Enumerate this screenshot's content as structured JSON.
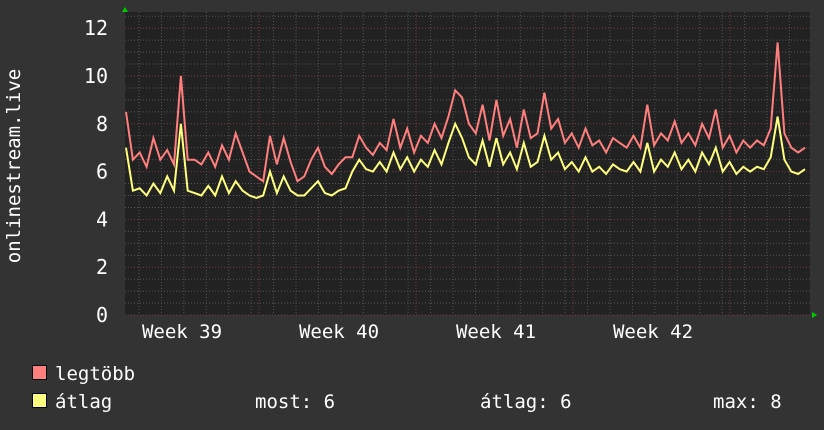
{
  "chart_data": {
    "type": "line",
    "title": "",
    "ylabel": "onlinestream.live",
    "xlabel": "",
    "ylim": [
      0,
      12.5
    ],
    "yticks": [
      "0",
      "2",
      "4",
      "6",
      "8",
      "10",
      "12"
    ],
    "xticks": [
      "Week 39",
      "Week 40",
      "Week 41",
      "Week 42"
    ],
    "grid": true,
    "legend_placement": "bottom-left",
    "series": [
      {
        "name": "legtöbb",
        "color": "#ff7f7f",
        "values": [
          8.5,
          6.5,
          6.8,
          6.2,
          7.4,
          6.5,
          6.9,
          6.3,
          10,
          6.5,
          6.5,
          6.3,
          6.8,
          6.2,
          7.1,
          6.5,
          7.6,
          6.8,
          6.0,
          5.8,
          5.6,
          7.5,
          6.3,
          7.4,
          6.4,
          5.6,
          5.8,
          6.5,
          7.0,
          6.2,
          5.9,
          6.3,
          6.6,
          6.6,
          7.5,
          7.0,
          6.7,
          7.2,
          6.9,
          8.2,
          7.0,
          7.8,
          6.8,
          7.5,
          7.2,
          8.0,
          7.4,
          8.3,
          9.4,
          9.1,
          8.0,
          7.6,
          8.8,
          7.3,
          9.0,
          7.5,
          8.2,
          7.0,
          8.6,
          7.4,
          7.6,
          9.3,
          7.8,
          8.2,
          7.2,
          7.6,
          7.0,
          7.8,
          7.1,
          7.3,
          6.8,
          7.4,
          7.2,
          7.0,
          7.5,
          7.0,
          8.8,
          7.1,
          7.6,
          7.3,
          8.1,
          7.2,
          7.6,
          7.1,
          8.0,
          7.4,
          8.6,
          7.0,
          7.5,
          6.8,
          7.3,
          7.0,
          7.3,
          7.1,
          7.8,
          11.4,
          7.6,
          7.0,
          6.8,
          7.0
        ]
      },
      {
        "name": "átlag",
        "color": "#ffff7f",
        "values": [
          7.0,
          5.2,
          5.3,
          5.0,
          5.5,
          5.1,
          5.8,
          5.2,
          8.0,
          5.2,
          5.1,
          5.0,
          5.4,
          5.0,
          5.8,
          5.1,
          5.6,
          5.2,
          5.0,
          4.9,
          5.0,
          6.0,
          5.1,
          5.8,
          5.2,
          5.0,
          5.0,
          5.3,
          5.6,
          5.1,
          5.0,
          5.2,
          5.3,
          6.0,
          6.5,
          6.1,
          6.0,
          6.4,
          6.0,
          6.8,
          6.1,
          6.6,
          6.0,
          6.5,
          6.2,
          6.9,
          6.3,
          7.2,
          8.0,
          7.4,
          6.6,
          6.3,
          7.3,
          6.2,
          7.4,
          6.3,
          6.8,
          6.1,
          7.2,
          6.2,
          6.4,
          7.5,
          6.5,
          6.8,
          6.1,
          6.4,
          6.0,
          6.6,
          6.0,
          6.2,
          5.9,
          6.3,
          6.1,
          6.0,
          6.4,
          6.0,
          7.2,
          6.0,
          6.5,
          6.2,
          6.8,
          6.1,
          6.5,
          6.0,
          6.8,
          6.3,
          7.0,
          6.0,
          6.4,
          5.9,
          6.2,
          6.0,
          6.2,
          6.1,
          6.6,
          8.3,
          6.5,
          6.0,
          5.9,
          6.1
        ]
      }
    ]
  },
  "legend": {
    "max_label": "legtöbb",
    "avg_label": "átlag",
    "now": "most: 6",
    "average": "átlag: 6",
    "max": "max: 8"
  }
}
